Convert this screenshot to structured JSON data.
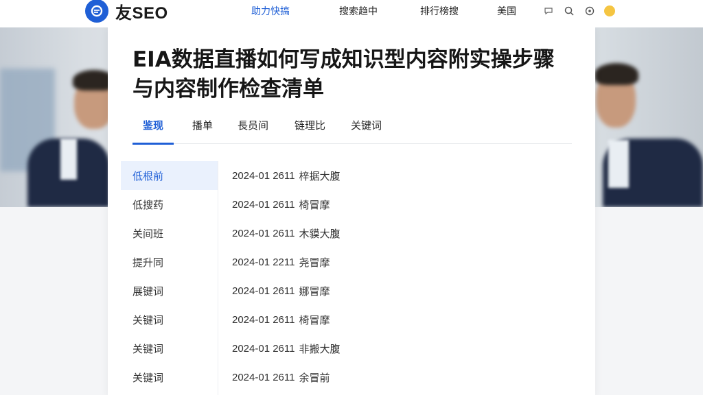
{
  "header": {
    "logo_text": "友SEO",
    "nav": [
      {
        "label": "助力快搞",
        "active": true
      },
      {
        "label": "搜索趋中",
        "active": false
      },
      {
        "label": "排行榜搜",
        "active": false
      },
      {
        "label": "美国",
        "active": false
      }
    ],
    "icons": [
      "message-icon",
      "search-icon",
      "settings-icon",
      "emoji-icon"
    ]
  },
  "article": {
    "title": "EIA数据直播如何写成知识型内容附实操步骤与内容制作检查清单",
    "tabs": [
      "鉴现",
      "播单",
      "長员间",
      "链理比",
      "关键词"
    ],
    "active_tab": 0
  },
  "sidebar": {
    "items": [
      "低根前",
      "低搜药",
      "关间班",
      "提升同",
      "展键词",
      "关键词",
      "关键词",
      "关键词"
    ],
    "active_index": 0
  },
  "list": {
    "rows": [
      {
        "date": "2024-01 2611",
        "text": "梓据大腹"
      },
      {
        "date": "2024-01 2611",
        "text": "椅冒摩"
      },
      {
        "date": "2024-01 2611",
        "text": "木貘大腹"
      },
      {
        "date": "2024-01 2211",
        "text": "尧冒摩"
      },
      {
        "date": "2024-01 2611",
        "text": "娜冒摩"
      },
      {
        "date": "2024-01 2611",
        "text": "椅冒摩"
      },
      {
        "date": "2024-01 2611",
        "text": "非搬大腹"
      },
      {
        "date": "2024-01 2611",
        "text": "余冒前"
      }
    ]
  },
  "colors": {
    "accent": "#1f5fd6",
    "active_bg": "#eaf1fd",
    "text": "#222222",
    "card_bg": "#ffffff"
  }
}
